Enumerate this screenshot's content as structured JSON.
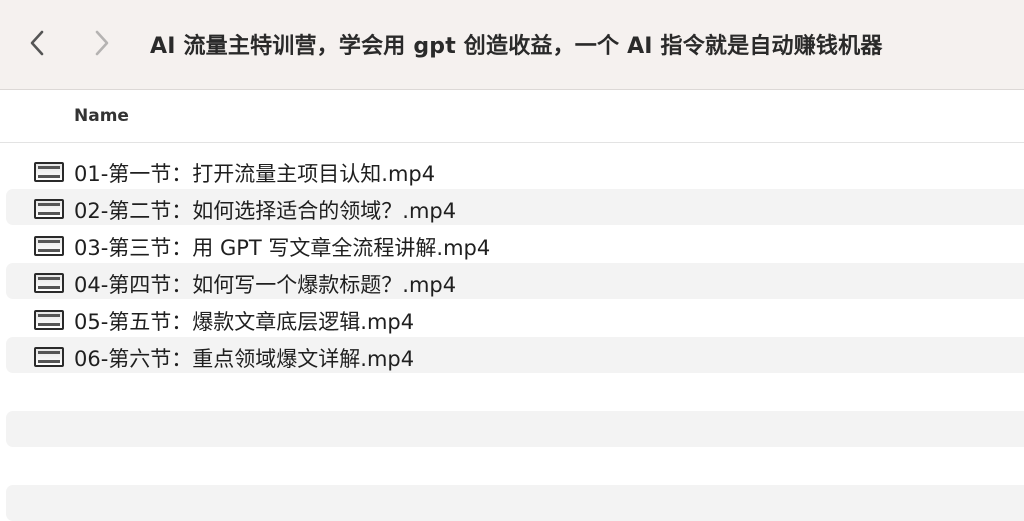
{
  "toolbar": {
    "title": "AI 流量主特训营，学会用 gpt 创造收益，一个 AI 指令就是自动赚钱机器",
    "back_icon": "chevron-left-icon",
    "forward_icon": "chevron-right-icon"
  },
  "columns": {
    "name": "Name"
  },
  "files": [
    {
      "name": "01-第一节：打开流量主项目认知.mp4",
      "icon": "video-file-icon"
    },
    {
      "name": "02-第二节：如何选择适合的领域？.mp4",
      "icon": "video-file-icon"
    },
    {
      "name": "03-第三节：用 GPT 写文章全流程讲解.mp4",
      "icon": "video-file-icon"
    },
    {
      "name": "04-第四节：如何写一个爆款标题？.mp4",
      "icon": "video-file-icon"
    },
    {
      "name": "05-第五节：爆款文章底层逻辑.mp4",
      "icon": "video-file-icon"
    },
    {
      "name": "06-第六节：重点领域爆文详解.mp4",
      "icon": "video-file-icon"
    }
  ],
  "colors": {
    "toolbar_bg": "#f5f1ef",
    "row_alt_bg": "#f3f3f3"
  }
}
